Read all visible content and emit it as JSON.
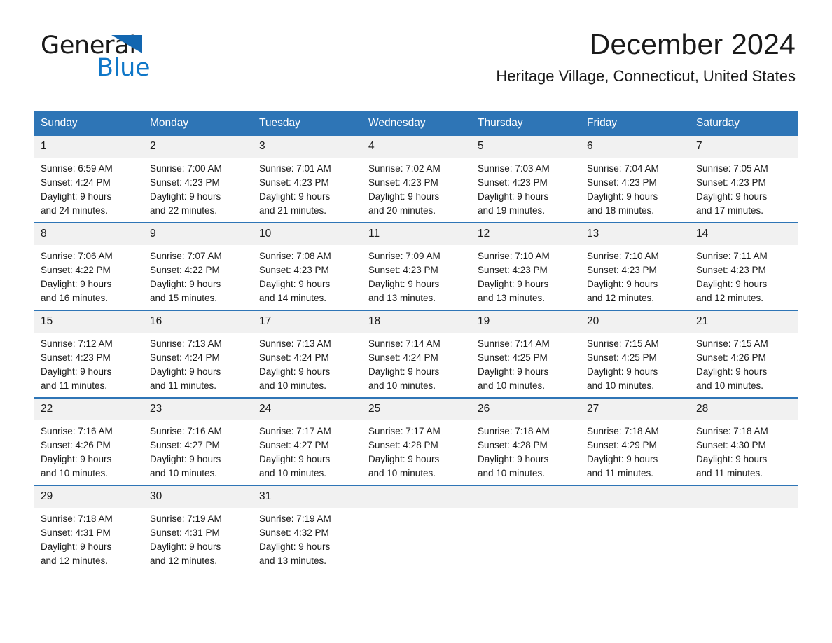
{
  "brand": {
    "word1": "General",
    "word2": "Blue",
    "flag_icon": "triangle-flag-icon",
    "accent_color": "#1266b0",
    "blue_text_color": "#0f77c8"
  },
  "header": {
    "month_title": "December 2024",
    "location": "Heritage Village, Connecticut, United States"
  },
  "calendar": {
    "header_bg": "#2e75b6",
    "daynum_bg": "#f1f1f1",
    "weekday_headers": [
      "Sunday",
      "Monday",
      "Tuesday",
      "Wednesday",
      "Thursday",
      "Friday",
      "Saturday"
    ],
    "weeks": [
      [
        {
          "day": "1",
          "sunrise": "Sunrise: 6:59 AM",
          "sunset": "Sunset: 4:24 PM",
          "daylight_1": "Daylight: 9 hours",
          "daylight_2": "and 24 minutes."
        },
        {
          "day": "2",
          "sunrise": "Sunrise: 7:00 AM",
          "sunset": "Sunset: 4:23 PM",
          "daylight_1": "Daylight: 9 hours",
          "daylight_2": "and 22 minutes."
        },
        {
          "day": "3",
          "sunrise": "Sunrise: 7:01 AM",
          "sunset": "Sunset: 4:23 PM",
          "daylight_1": "Daylight: 9 hours",
          "daylight_2": "and 21 minutes."
        },
        {
          "day": "4",
          "sunrise": "Sunrise: 7:02 AM",
          "sunset": "Sunset: 4:23 PM",
          "daylight_1": "Daylight: 9 hours",
          "daylight_2": "and 20 minutes."
        },
        {
          "day": "5",
          "sunrise": "Sunrise: 7:03 AM",
          "sunset": "Sunset: 4:23 PM",
          "daylight_1": "Daylight: 9 hours",
          "daylight_2": "and 19 minutes."
        },
        {
          "day": "6",
          "sunrise": "Sunrise: 7:04 AM",
          "sunset": "Sunset: 4:23 PM",
          "daylight_1": "Daylight: 9 hours",
          "daylight_2": "and 18 minutes."
        },
        {
          "day": "7",
          "sunrise": "Sunrise: 7:05 AM",
          "sunset": "Sunset: 4:23 PM",
          "daylight_1": "Daylight: 9 hours",
          "daylight_2": "and 17 minutes."
        }
      ],
      [
        {
          "day": "8",
          "sunrise": "Sunrise: 7:06 AM",
          "sunset": "Sunset: 4:22 PM",
          "daylight_1": "Daylight: 9 hours",
          "daylight_2": "and 16 minutes."
        },
        {
          "day": "9",
          "sunrise": "Sunrise: 7:07 AM",
          "sunset": "Sunset: 4:22 PM",
          "daylight_1": "Daylight: 9 hours",
          "daylight_2": "and 15 minutes."
        },
        {
          "day": "10",
          "sunrise": "Sunrise: 7:08 AM",
          "sunset": "Sunset: 4:23 PM",
          "daylight_1": "Daylight: 9 hours",
          "daylight_2": "and 14 minutes."
        },
        {
          "day": "11",
          "sunrise": "Sunrise: 7:09 AM",
          "sunset": "Sunset: 4:23 PM",
          "daylight_1": "Daylight: 9 hours",
          "daylight_2": "and 13 minutes."
        },
        {
          "day": "12",
          "sunrise": "Sunrise: 7:10 AM",
          "sunset": "Sunset: 4:23 PM",
          "daylight_1": "Daylight: 9 hours",
          "daylight_2": "and 13 minutes."
        },
        {
          "day": "13",
          "sunrise": "Sunrise: 7:10 AM",
          "sunset": "Sunset: 4:23 PM",
          "daylight_1": "Daylight: 9 hours",
          "daylight_2": "and 12 minutes."
        },
        {
          "day": "14",
          "sunrise": "Sunrise: 7:11 AM",
          "sunset": "Sunset: 4:23 PM",
          "daylight_1": "Daylight: 9 hours",
          "daylight_2": "and 12 minutes."
        }
      ],
      [
        {
          "day": "15",
          "sunrise": "Sunrise: 7:12 AM",
          "sunset": "Sunset: 4:23 PM",
          "daylight_1": "Daylight: 9 hours",
          "daylight_2": "and 11 minutes."
        },
        {
          "day": "16",
          "sunrise": "Sunrise: 7:13 AM",
          "sunset": "Sunset: 4:24 PM",
          "daylight_1": "Daylight: 9 hours",
          "daylight_2": "and 11 minutes."
        },
        {
          "day": "17",
          "sunrise": "Sunrise: 7:13 AM",
          "sunset": "Sunset: 4:24 PM",
          "daylight_1": "Daylight: 9 hours",
          "daylight_2": "and 10 minutes."
        },
        {
          "day": "18",
          "sunrise": "Sunrise: 7:14 AM",
          "sunset": "Sunset: 4:24 PM",
          "daylight_1": "Daylight: 9 hours",
          "daylight_2": "and 10 minutes."
        },
        {
          "day": "19",
          "sunrise": "Sunrise: 7:14 AM",
          "sunset": "Sunset: 4:25 PM",
          "daylight_1": "Daylight: 9 hours",
          "daylight_2": "and 10 minutes."
        },
        {
          "day": "20",
          "sunrise": "Sunrise: 7:15 AM",
          "sunset": "Sunset: 4:25 PM",
          "daylight_1": "Daylight: 9 hours",
          "daylight_2": "and 10 minutes."
        },
        {
          "day": "21",
          "sunrise": "Sunrise: 7:15 AM",
          "sunset": "Sunset: 4:26 PM",
          "daylight_1": "Daylight: 9 hours",
          "daylight_2": "and 10 minutes."
        }
      ],
      [
        {
          "day": "22",
          "sunrise": "Sunrise: 7:16 AM",
          "sunset": "Sunset: 4:26 PM",
          "daylight_1": "Daylight: 9 hours",
          "daylight_2": "and 10 minutes."
        },
        {
          "day": "23",
          "sunrise": "Sunrise: 7:16 AM",
          "sunset": "Sunset: 4:27 PM",
          "daylight_1": "Daylight: 9 hours",
          "daylight_2": "and 10 minutes."
        },
        {
          "day": "24",
          "sunrise": "Sunrise: 7:17 AM",
          "sunset": "Sunset: 4:27 PM",
          "daylight_1": "Daylight: 9 hours",
          "daylight_2": "and 10 minutes."
        },
        {
          "day": "25",
          "sunrise": "Sunrise: 7:17 AM",
          "sunset": "Sunset: 4:28 PM",
          "daylight_1": "Daylight: 9 hours",
          "daylight_2": "and 10 minutes."
        },
        {
          "day": "26",
          "sunrise": "Sunrise: 7:18 AM",
          "sunset": "Sunset: 4:28 PM",
          "daylight_1": "Daylight: 9 hours",
          "daylight_2": "and 10 minutes."
        },
        {
          "day": "27",
          "sunrise": "Sunrise: 7:18 AM",
          "sunset": "Sunset: 4:29 PM",
          "daylight_1": "Daylight: 9 hours",
          "daylight_2": "and 11 minutes."
        },
        {
          "day": "28",
          "sunrise": "Sunrise: 7:18 AM",
          "sunset": "Sunset: 4:30 PM",
          "daylight_1": "Daylight: 9 hours",
          "daylight_2": "and 11 minutes."
        }
      ],
      [
        {
          "day": "29",
          "sunrise": "Sunrise: 7:18 AM",
          "sunset": "Sunset: 4:31 PM",
          "daylight_1": "Daylight: 9 hours",
          "daylight_2": "and 12 minutes."
        },
        {
          "day": "30",
          "sunrise": "Sunrise: 7:19 AM",
          "sunset": "Sunset: 4:31 PM",
          "daylight_1": "Daylight: 9 hours",
          "daylight_2": "and 12 minutes."
        },
        {
          "day": "31",
          "sunrise": "Sunrise: 7:19 AM",
          "sunset": "Sunset: 4:32 PM",
          "daylight_1": "Daylight: 9 hours",
          "daylight_2": "and 13 minutes."
        },
        {
          "day": "",
          "sunrise": "",
          "sunset": "",
          "daylight_1": "",
          "daylight_2": ""
        },
        {
          "day": "",
          "sunrise": "",
          "sunset": "",
          "daylight_1": "",
          "daylight_2": ""
        },
        {
          "day": "",
          "sunrise": "",
          "sunset": "",
          "daylight_1": "",
          "daylight_2": ""
        },
        {
          "day": "",
          "sunrise": "",
          "sunset": "",
          "daylight_1": "",
          "daylight_2": ""
        }
      ]
    ]
  }
}
